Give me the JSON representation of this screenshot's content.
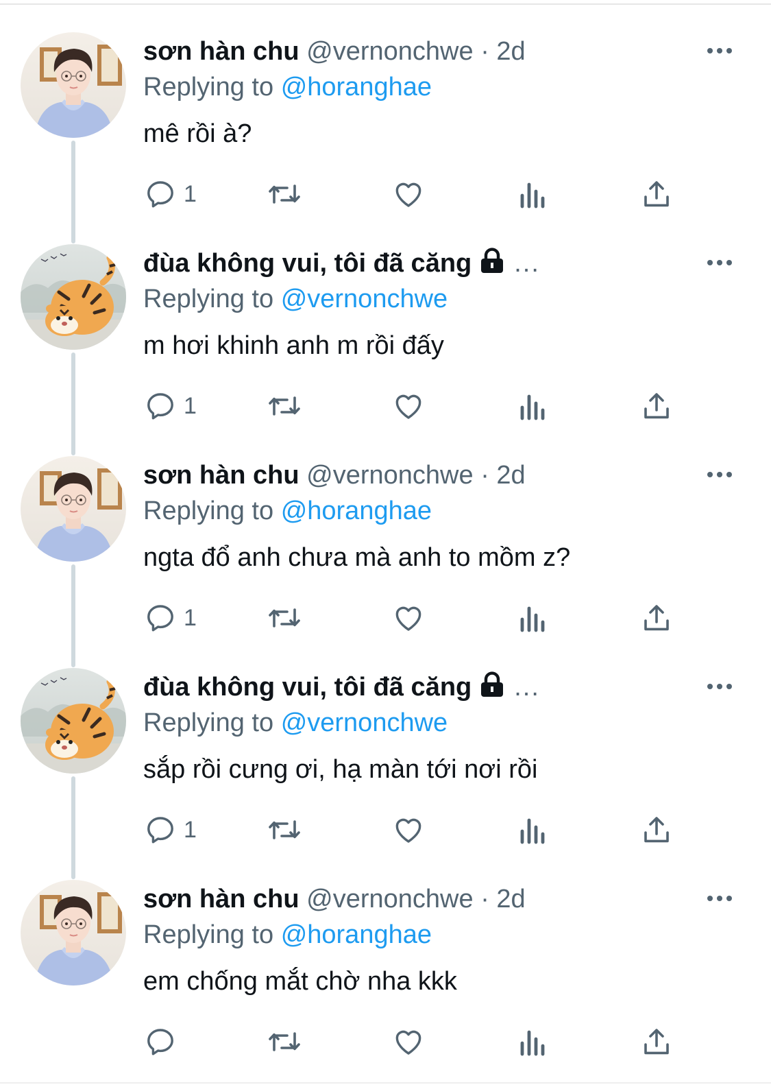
{
  "tweets": [
    {
      "avatar": "person-avatar",
      "name": "sơn hàn chu",
      "handle": "@vernonchwe",
      "separator": "·",
      "time": "2d",
      "protected": false,
      "replying_label": "Replying to",
      "replying_to": "@horanghae",
      "text": "mê rồi à?",
      "reply_count": "1"
    },
    {
      "avatar": "tiger-avatar",
      "name": "đùa không vui, tôi đã căng",
      "handle": "",
      "separator": "",
      "time": "",
      "protected": true,
      "truncation": "...",
      "replying_label": "Replying to",
      "replying_to": "@vernonchwe",
      "text": "m hơi khinh anh m rồi đấy",
      "reply_count": "1"
    },
    {
      "avatar": "person-avatar",
      "name": "sơn hàn chu",
      "handle": "@vernonchwe",
      "separator": "·",
      "time": "2d",
      "protected": false,
      "replying_label": "Replying to",
      "replying_to": "@horanghae",
      "text": "ngta đổ anh chưa mà anh to mồm z?",
      "reply_count": "1"
    },
    {
      "avatar": "tiger-avatar",
      "name": "đùa không vui, tôi đã căng",
      "handle": "",
      "separator": "",
      "time": "",
      "protected": true,
      "truncation": "...",
      "replying_label": "Replying to",
      "replying_to": "@vernonchwe",
      "text": "sắp rồi cưng ơi, hạ màn tới nơi rồi",
      "reply_count": "1"
    },
    {
      "avatar": "person-avatar",
      "name": "sơn hàn chu",
      "handle": "@vernonchwe",
      "separator": "·",
      "time": "2d",
      "protected": false,
      "replying_label": "Replying to",
      "replying_to": "@horanghae",
      "text": "em chống mắt chờ nha kkk",
      "reply_count": ""
    }
  ],
  "icons": {
    "reply": "reply-icon",
    "retweet": "retweet-icon",
    "like": "like-icon",
    "views": "views-icon",
    "share": "share-icon",
    "more": "more-icon",
    "lock": "lock-icon"
  },
  "colors": {
    "name": "#0f1419",
    "secondary": "#536471",
    "mention": "#1d9bf0",
    "thread_line": "#cfd9de"
  }
}
